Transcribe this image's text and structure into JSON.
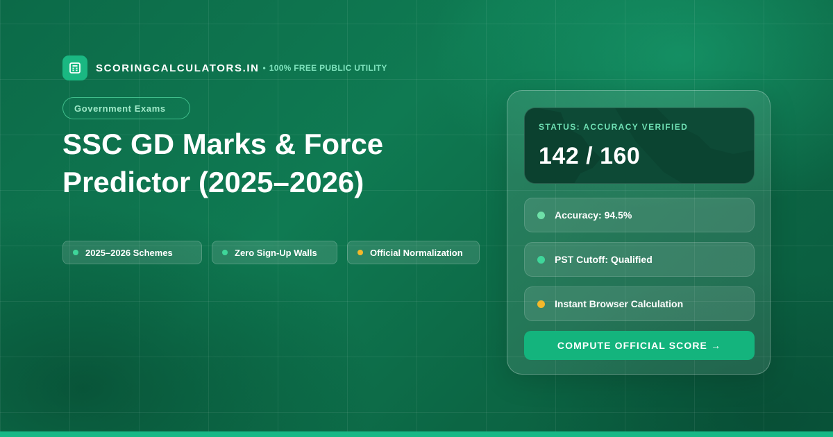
{
  "brand": {
    "name": "SCORINGCALCULATORS.IN",
    "separator": "•",
    "tagline": "100% FREE PUBLIC UTILITY",
    "icon": "calculator-icon"
  },
  "category": "Government Exams",
  "title": {
    "line1": "SSC GD Marks & Force",
    "line2": "Predictor (2025–2026)"
  },
  "features": [
    {
      "label": "2025–2026 Schemes",
      "dot_color": "#3fd69a"
    },
    {
      "label": "Zero Sign-Up Walls",
      "dot_color": "#3fd69a"
    },
    {
      "label": "Official Normalization",
      "dot_color": "#f4b82a"
    }
  ],
  "card": {
    "status_label": "STATUS: ACCURACY VERIFIED",
    "status_value": "142 / 160",
    "rows": [
      {
        "label": "Accuracy: 94.5%",
        "dot_color": "#6ee0a8"
      },
      {
        "label": "PST Cutoff: Qualified",
        "dot_color": "#3fd69a"
      },
      {
        "label": "Instant Browser Calculation",
        "dot_color": "#f4b82a"
      }
    ],
    "cta_label": "COMPUTE OFFICIAL SCORE →"
  },
  "colors": {
    "accent": "#14b47d",
    "background": "#0c6a48",
    "highlight_text": "#7ee3bd",
    "warning_dot": "#f4b82a"
  }
}
